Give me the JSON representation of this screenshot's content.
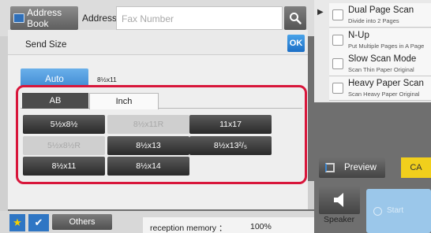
{
  "address_bar": {
    "address_book_label": "Address Book",
    "address_label": "Address",
    "fax_placeholder": "Fax Number"
  },
  "functions": [
    {
      "title": "Dual Page Scan",
      "subtitle": "Divide into 2 Pages"
    },
    {
      "title": "N-Up",
      "subtitle": "Put Multiple Pages in A Page"
    },
    {
      "title": "Slow Scan Mode",
      "subtitle": "Scan Thin Paper Original"
    },
    {
      "title": "Heavy Paper Scan",
      "subtitle": "Scan Heavy Paper Original"
    }
  ],
  "dialog": {
    "title": "Send Size",
    "ok_label": "OK",
    "auto_label": "Auto",
    "auto_value": "8½x11",
    "tabs": [
      {
        "label": "AB",
        "active": false
      },
      {
        "label": "Inch",
        "active": true
      }
    ],
    "sizes": [
      {
        "label": "5½x8½",
        "enabled": true
      },
      {
        "label": "8½x11R",
        "enabled": false
      },
      {
        "label": "11x17",
        "enabled": true
      },
      {
        "label": "5½x8½R",
        "enabled": false
      },
      {
        "label": "8½x13",
        "enabled": true
      },
      {
        "label": "8½x13²/₅",
        "enabled": true
      },
      {
        "label": "8½x11",
        "enabled": true
      },
      {
        "label": "8½x14",
        "enabled": true
      }
    ]
  },
  "controls": {
    "preview_label": "Preview",
    "ca_label": "CA",
    "speaker_label": "Speaker",
    "start_label": "Start"
  },
  "bottom": {
    "others_label": "Others",
    "memory_label": "reception memory ：",
    "memory_value": "100%"
  },
  "colors": {
    "accent_blue": "#1c6fc6",
    "highlight_red": "#d8163b",
    "ca_yellow": "#f1cf1c"
  }
}
